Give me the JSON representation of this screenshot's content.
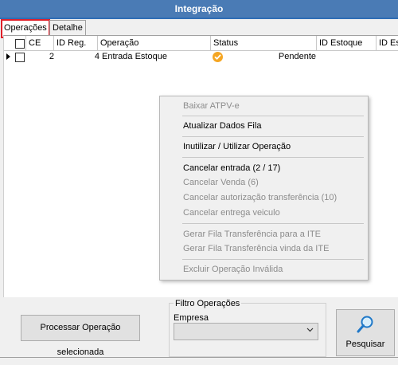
{
  "window": {
    "title": "Integração"
  },
  "tabs": [
    {
      "label": "Operações",
      "active": true
    },
    {
      "label": "Detalhe",
      "active": false
    }
  ],
  "grid": {
    "columns": [
      "CE",
      "ID Reg.",
      "Operação",
      "Status",
      "ID Estoque",
      "ID Es"
    ],
    "rows": [
      {
        "ce": "2",
        "id_reg": "4",
        "operacao": "Entrada Estoque",
        "status_icon": "check-circle-icon",
        "status": "Pendente",
        "id_estoque": ""
      }
    ]
  },
  "context_menu": {
    "items": [
      {
        "label": "Baixar ATPV-e",
        "enabled": false
      },
      {
        "label": "Atualizar Dados Fila",
        "enabled": true
      },
      {
        "label": "Inutilizar / Utilizar Operação",
        "enabled": true
      },
      {
        "label": "Cancelar entrada (2 / 17)",
        "enabled": true
      },
      {
        "label": "Cancelar Venda (6)",
        "enabled": false
      },
      {
        "label": "Cancelar autorização transferência (10)",
        "enabled": false
      },
      {
        "label": "Cancelar entrega veiculo",
        "enabled": false
      },
      {
        "label": "Gerar Fila Transferência para a ITE",
        "enabled": false
      },
      {
        "label": "Gerar Fila Transferência vinda da ITE",
        "enabled": false
      },
      {
        "label": "Excluir Operação Inválida",
        "enabled": false
      }
    ]
  },
  "bottom": {
    "process_button": "Processar Operação selecionada",
    "filter_legend": "Filtro Operações",
    "empresa_label": "Empresa",
    "empresa_value": "",
    "search_button": "Pesquisar",
    "search_icon": "magnifier-icon"
  },
  "colors": {
    "titlebar": "#4a7bb5",
    "active_tab_border": "#e0202a",
    "status_icon": "#f5a623"
  }
}
